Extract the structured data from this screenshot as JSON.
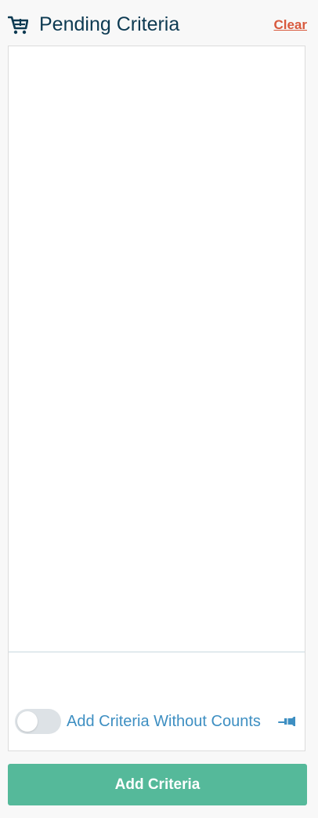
{
  "header": {
    "icon": "shopping-cart-icon",
    "title": "Pending Criteria",
    "clear_label": "Clear"
  },
  "criteria_panel": {
    "items": []
  },
  "options": {
    "without_counts_label": "Add Criteria Without Counts",
    "without_counts_enabled": false,
    "pin_icon": "pin-icon"
  },
  "actions": {
    "add_criteria_label": "Add Criteria"
  },
  "colors": {
    "title": "#0d3a52",
    "clear_link": "#d8593d",
    "link_blue": "#3e8fc2",
    "button_green": "#55b99a",
    "toggle_off": "#dde2e6"
  }
}
